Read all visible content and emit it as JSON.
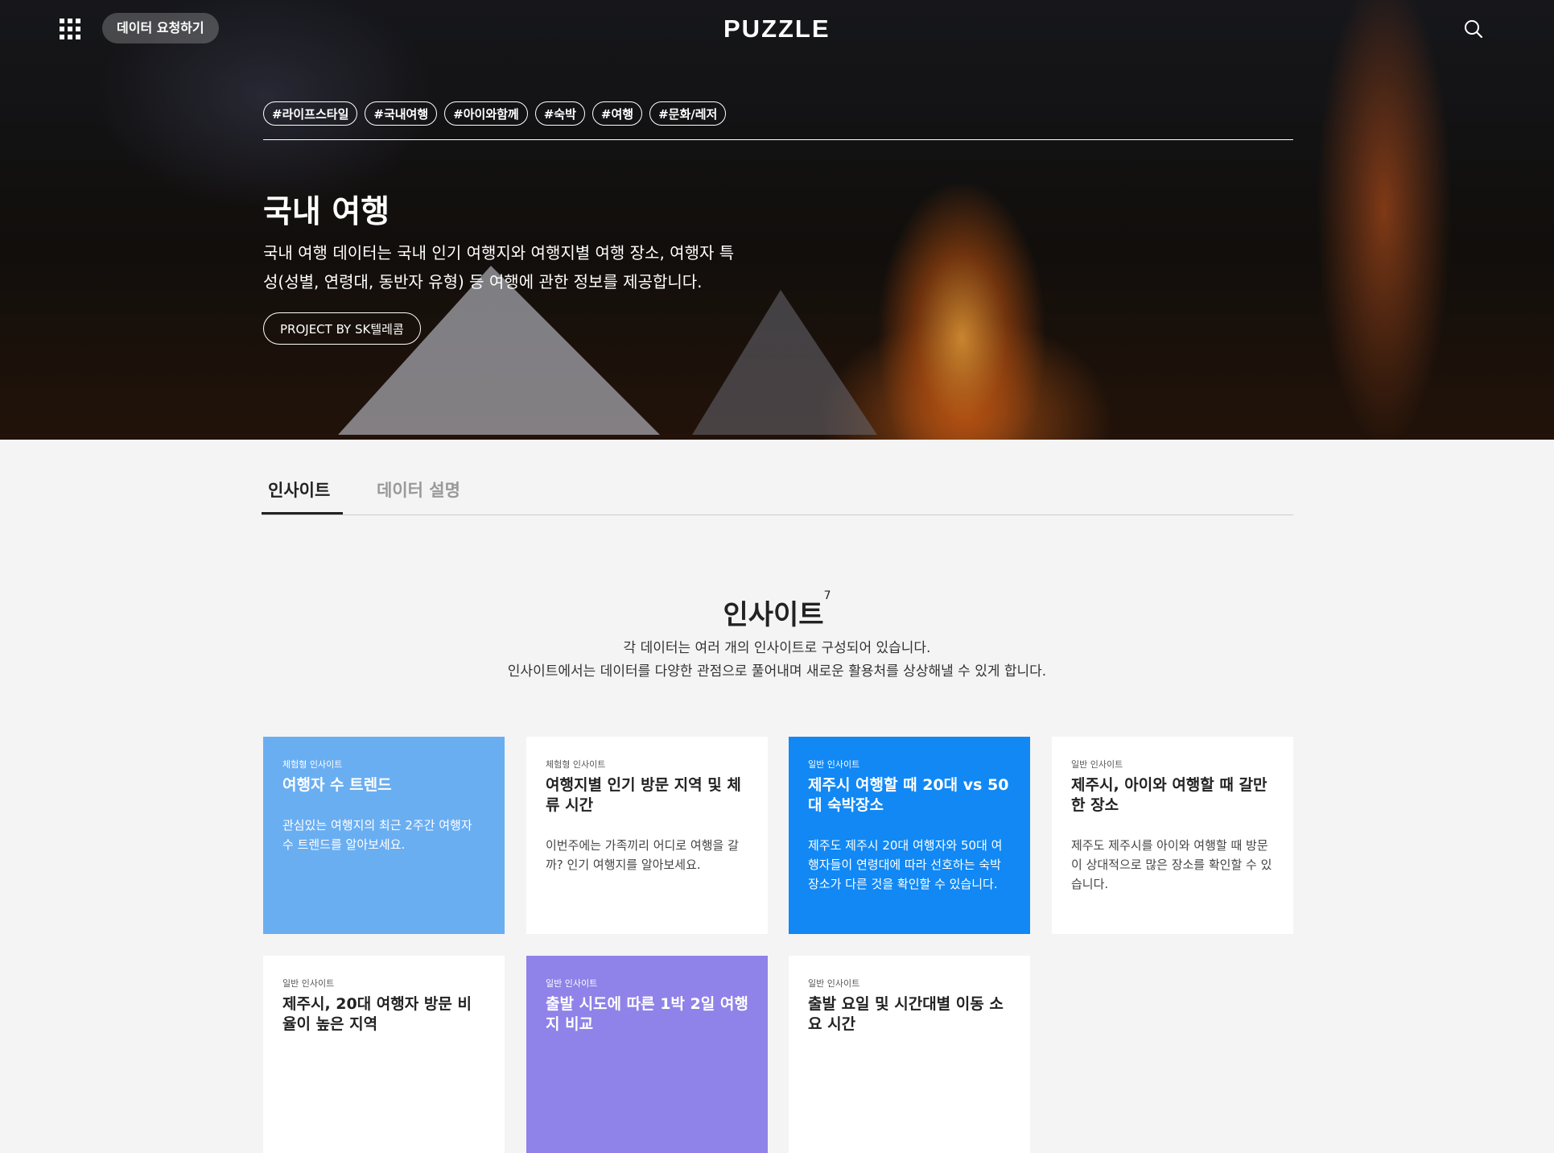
{
  "header": {
    "request_label": "데이터 요청하기",
    "logo": "PUZZLE",
    "menu_icon": "grid-menu-icon",
    "search_icon": "search-icon"
  },
  "hero": {
    "tags": [
      "#라이프스타일",
      "#국내여행",
      "#아이와함께",
      "#숙박",
      "#여행",
      "#문화/레저"
    ],
    "title": "국내 여행",
    "description_line1": "국내 여행 데이터는 국내 인기 여행지와 여행지별 여행 장소, 여행자 특",
    "description_line2": "성(성별, 연령대, 동반자 유형) 등 여행에 관한 정보를 제공합니다.",
    "project_label": "PROJECT BY SK텔레콤"
  },
  "tabs": [
    {
      "label": "인사이트",
      "active": true
    },
    {
      "label": "데이터 설명",
      "active": false
    }
  ],
  "section": {
    "title": "인사이트",
    "count": "7",
    "subtitle_line1": "각 데이터는 여러 개의 인사이트로 구성되어 있습니다.",
    "subtitle_line2": "인사이트에서는 데이터를 다양한 관점으로 풀어내며 새로운 활용처를 상상해낼 수 있게 합니다."
  },
  "cards": [
    {
      "kind": "체험형 인사이트",
      "title": "여행자 수 트렌드",
      "desc": "관심있는 여행지의 최근 2주간 여행자 수 트렌드를 알아보세요.",
      "color": "#6aaef2"
    },
    {
      "kind": "체험형 인사이트",
      "title": "여행지별 인기 방문 지역 및 체류 시간",
      "desc": "이번주에는 가족끼리 어디로 여행을 갈까? 인기 여행지를 알아보세요.",
      "color": "#ffffff"
    },
    {
      "kind": "일반 인사이트",
      "title": "제주시 여행할 때 20대 vs 50대 숙박장소",
      "desc": "제주도 제주시 20대 여행자와 50대 여행자들이 연령대에 따라 선호하는 숙박 장소가 다른 것을 확인할 수 있습니다.",
      "color": "#1188f4"
    },
    {
      "kind": "일반 인사이트",
      "title": "제주시, 아이와 여행할 때 갈만한 장소",
      "desc": "제주도 제주시를 아이와 여행할 때 방문이 상대적으로 많은 장소를 확인할 수 있습니다.",
      "color": "#ffffff"
    },
    {
      "kind": "일반 인사이트",
      "title": "제주시, 20대 여행자 방문 비율이 높은 지역",
      "desc": "",
      "color": "#ffffff"
    },
    {
      "kind": "일반 인사이트",
      "title": "출발 시도에 따른 1박 2일 여행지 비교",
      "desc": "",
      "color": "#8f82e8"
    },
    {
      "kind": "일반 인사이트",
      "title": "출발 요일 및 시간대별 이동 소요 시간",
      "desc": "",
      "color": "#ffffff"
    }
  ]
}
